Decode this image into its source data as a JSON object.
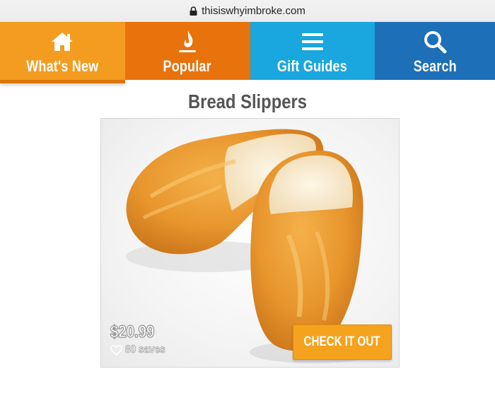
{
  "browser": {
    "url": "thisiswhyimbroke.com"
  },
  "nav": {
    "items": [
      {
        "label": "What's New",
        "icon": "home-icon"
      },
      {
        "label": "Popular",
        "icon": "flame-icon"
      },
      {
        "label": "Gift Guides",
        "icon": "menu-icon"
      },
      {
        "label": "Search",
        "icon": "search-icon"
      }
    ]
  },
  "product": {
    "title": "Bread Slippers",
    "image": "bread-slippers-image",
    "price": "$20.99",
    "saves": "80 saves",
    "cta_label": "CHECK IT OUT"
  },
  "colors": {
    "whats_new": "#f39c1f",
    "popular": "#e8720c",
    "gift_guides": "#1aa6de",
    "search": "#1d6fb8",
    "cta": "#f5a21e"
  }
}
